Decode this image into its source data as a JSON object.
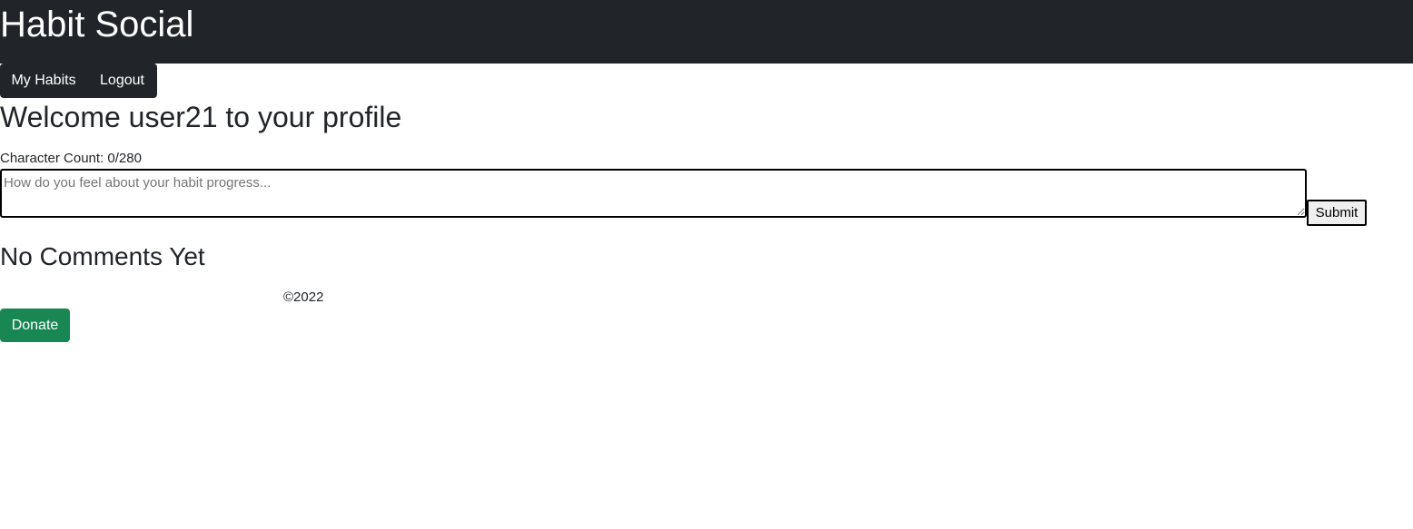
{
  "header": {
    "title": "Habit Social"
  },
  "nav": {
    "items": [
      {
        "label": "My Habits"
      },
      {
        "label": "Logout"
      }
    ]
  },
  "profile": {
    "welcome": "Welcome user21 to your profile"
  },
  "comment_form": {
    "char_count": "Character Count: 0/280",
    "placeholder": "How do you feel about your habit progress...",
    "value": "",
    "submit_label": "Submit"
  },
  "comments": {
    "empty_message": "No Comments Yet"
  },
  "footer": {
    "copyright": "©2022",
    "donate_label": "Donate"
  },
  "colors": {
    "header_bg": "#212529",
    "donate_bg": "#198754"
  }
}
